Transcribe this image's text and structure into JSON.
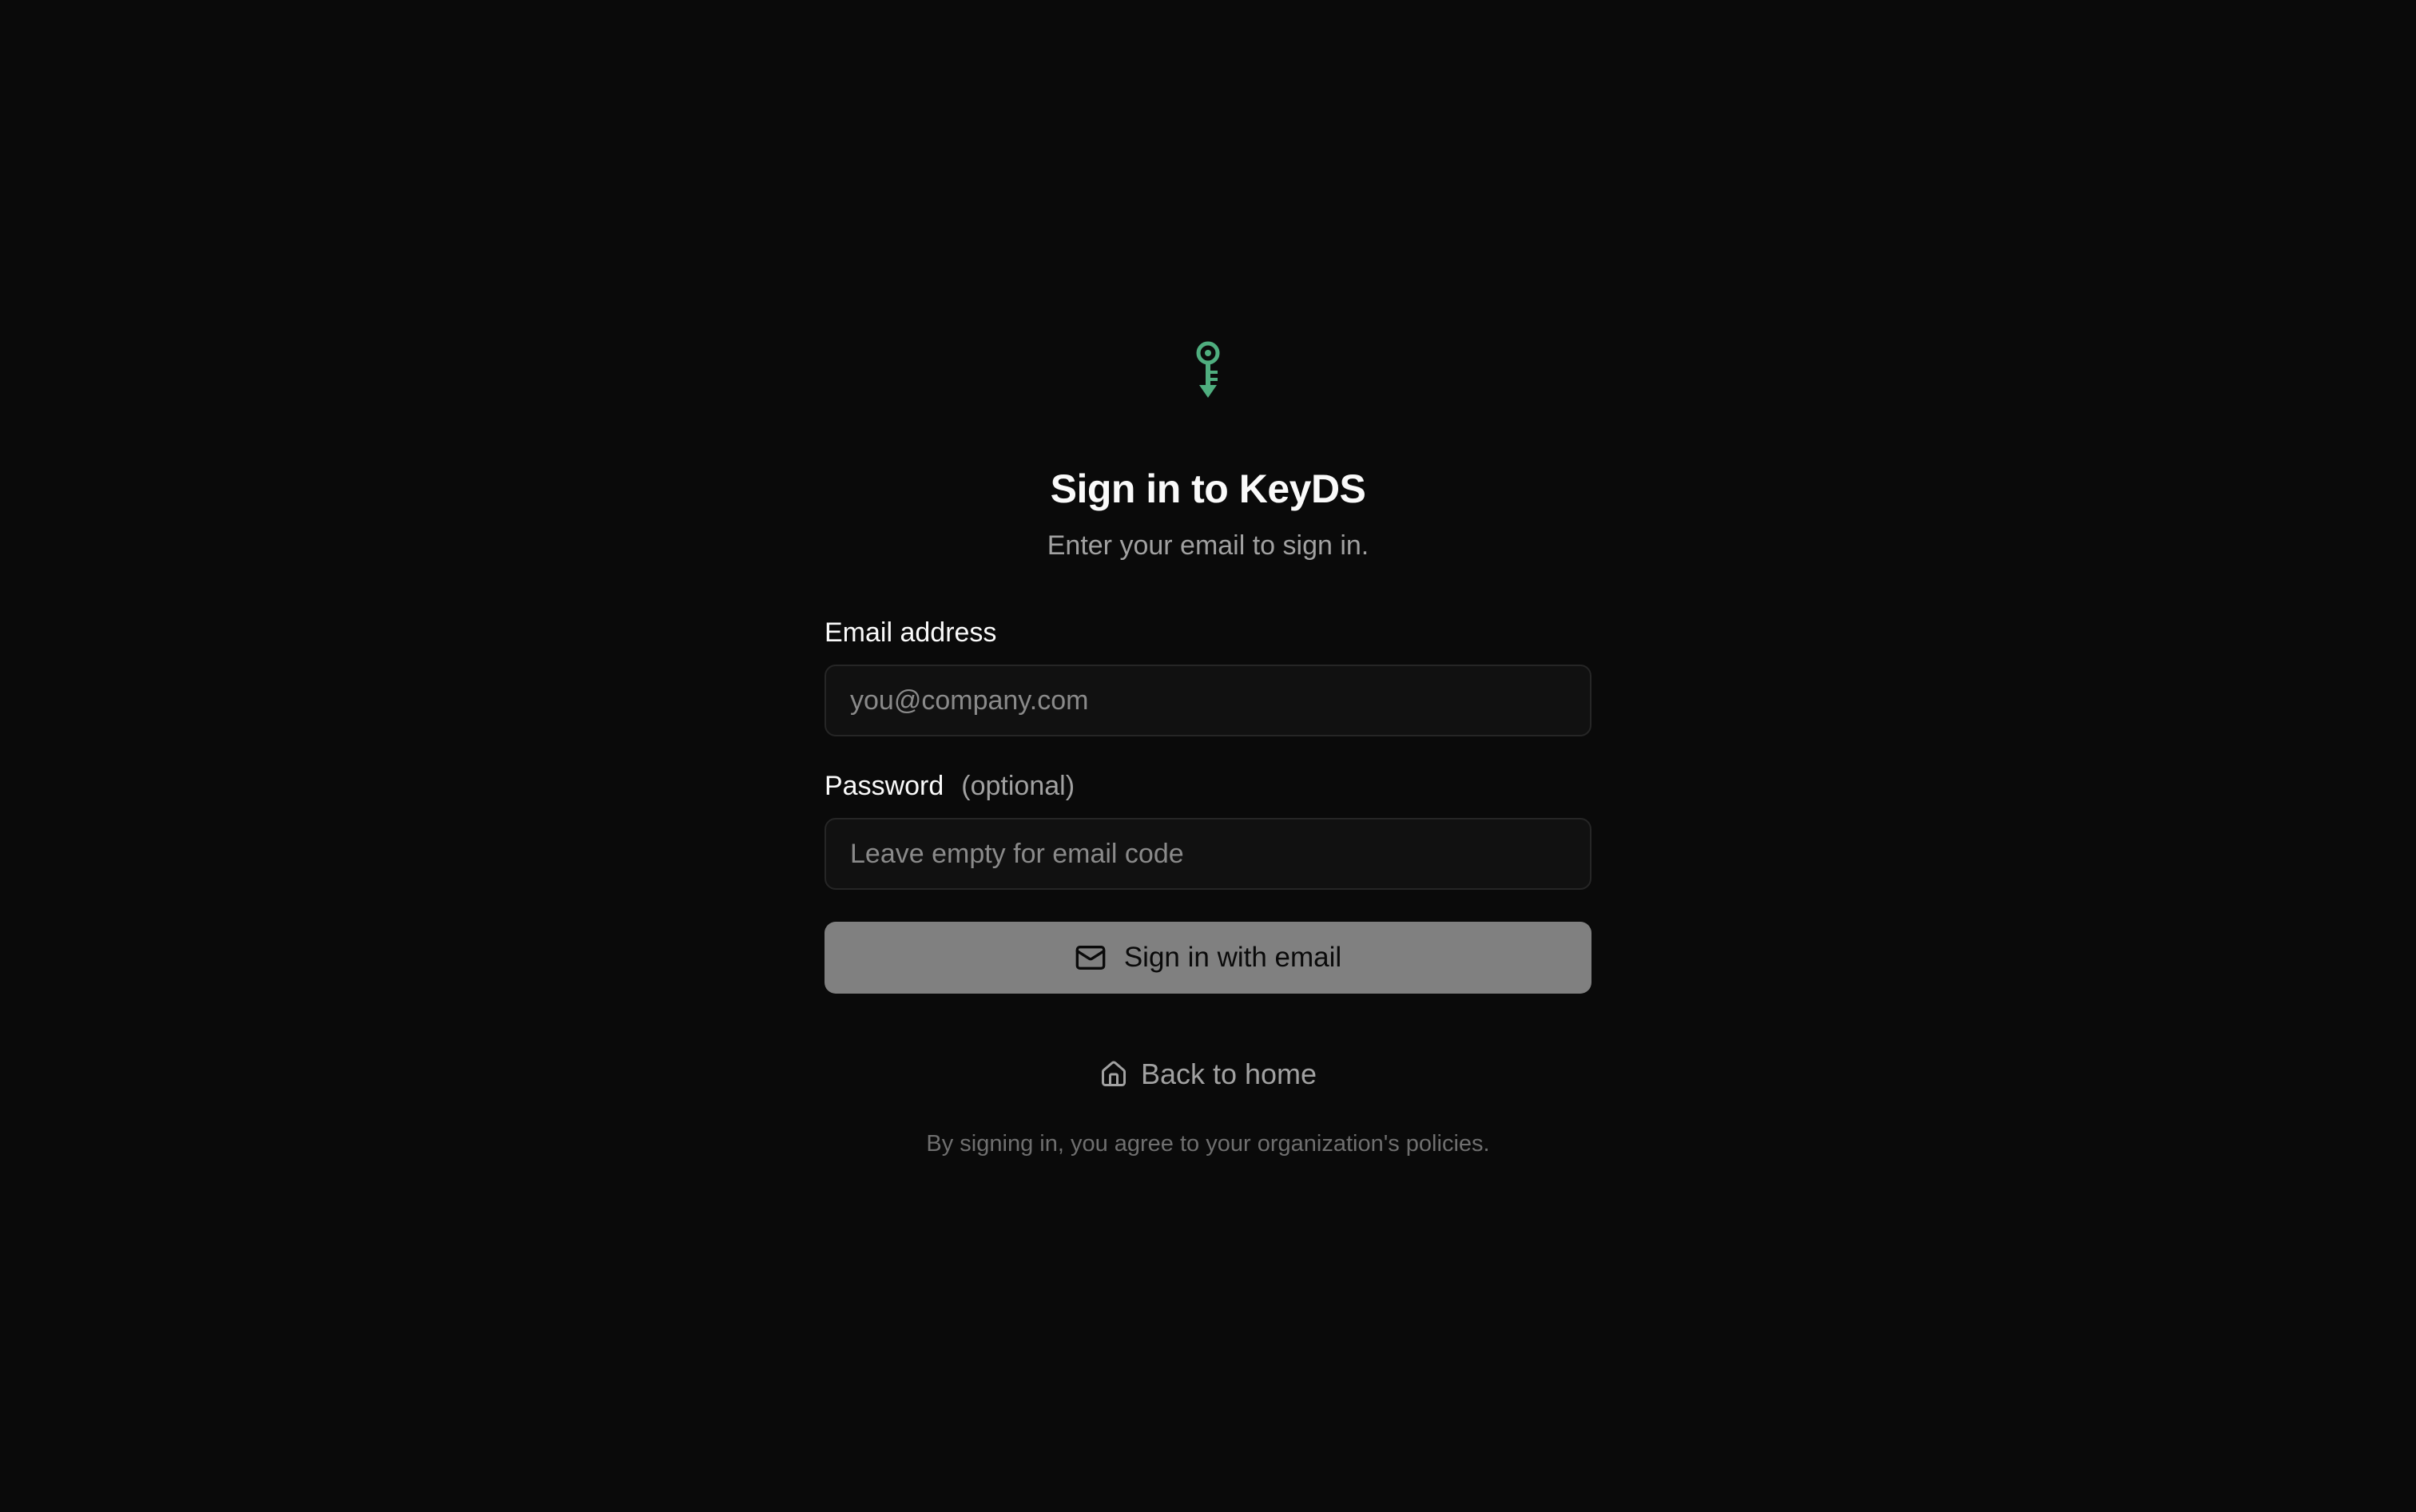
{
  "brand": {
    "logo_icon": "key-icon",
    "accent_color": "#4fae7f"
  },
  "header": {
    "title": "Sign in to KeyDS",
    "subtitle": "Enter your email to sign in."
  },
  "form": {
    "email": {
      "label": "Email address",
      "placeholder": "you@company.com",
      "value": ""
    },
    "password": {
      "label": "Password",
      "hint": "(optional)",
      "placeholder": "Leave empty for email code",
      "value": ""
    },
    "submit": {
      "icon": "mail-icon",
      "label": "Sign in with email"
    }
  },
  "footer": {
    "back_link": {
      "icon": "home-icon",
      "label": "Back to home"
    },
    "legal": "By signing in, you agree to your organization's policies."
  }
}
